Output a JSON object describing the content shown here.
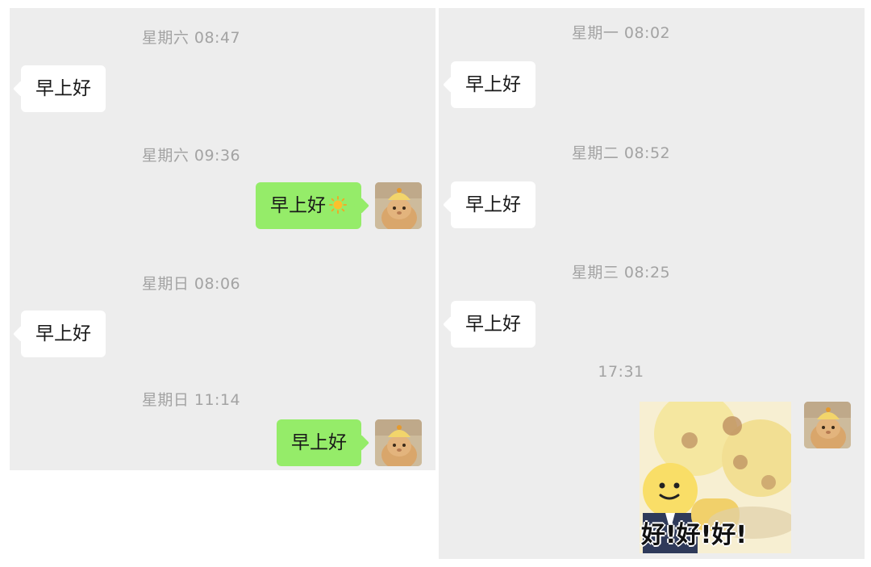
{
  "left": {
    "messages": [
      {
        "time": "星期六 08:47",
        "text": "早上好",
        "from": "other"
      },
      {
        "time": "星期六 09:36",
        "text": "早上好",
        "from": "me",
        "emoji": "sun-emoji"
      },
      {
        "time": "星期日 08:06",
        "text": "早上好",
        "from": "other"
      },
      {
        "time": "星期日 11:14",
        "text": "早上好",
        "from": "me"
      }
    ]
  },
  "right": {
    "messages": [
      {
        "time": "星期一 08:02",
        "text": "早上好",
        "from": "other"
      },
      {
        "time": "星期二 08:52",
        "text": "早上好",
        "from": "other"
      },
      {
        "time": "星期三 08:25",
        "text": "早上好",
        "from": "other"
      },
      {
        "time": "17:31",
        "from": "me",
        "type": "sticker",
        "sticker_text": "好!好!好!"
      }
    ]
  },
  "colors": {
    "chat_background": "#ededed",
    "incoming_bubble": "#ffffff",
    "outgoing_bubble": "#95ec69",
    "timestamp": "#a3a3a3"
  }
}
